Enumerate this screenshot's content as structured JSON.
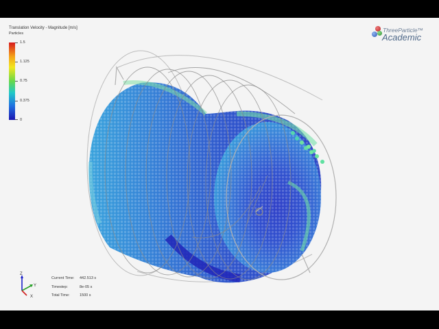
{
  "legend": {
    "title": "Translation Velocity - Magnitude [m/s]",
    "subtitle": "Particles",
    "ticks": [
      "1.5",
      "1.125",
      "0.75",
      "0.375",
      "0"
    ],
    "colors": [
      "#d7191c",
      "#f4a218",
      "#f2e61d",
      "#66d84a",
      "#20c8c8",
      "#1f6fe0",
      "#1a15b0"
    ]
  },
  "logo": {
    "brand": "ThreeParticle™",
    "product": "Academic"
  },
  "triad": {
    "z": "Z",
    "y": "Y",
    "x": "X"
  },
  "info": {
    "current_time_label": "Current Time:",
    "current_time_value": "442.513 s",
    "timestep_label": "Timestep:",
    "timestep_value": "8e-05 s",
    "total_time_label": "Total Time:",
    "total_time_value": "1500 s"
  }
}
